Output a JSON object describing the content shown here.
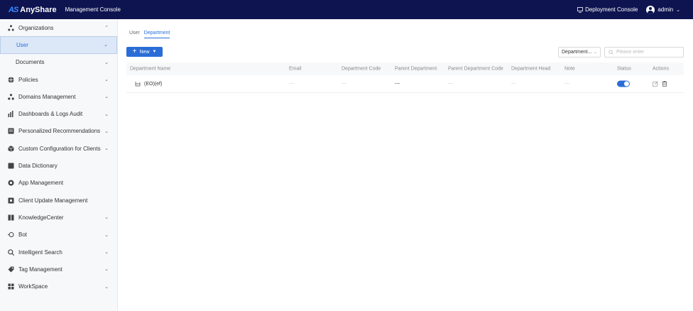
{
  "topbar": {
    "logo_mark": "AS",
    "logo_text": "AnyShare",
    "console_title": "Management Console",
    "deployment_console": "Deployment Console",
    "username": "admin"
  },
  "sidebar": {
    "items": [
      {
        "label": "Organizations",
        "icon": "organization-icon",
        "chevron": "⌃"
      },
      {
        "label": "User",
        "icon": "",
        "chevron": "⌄",
        "active": true,
        "sub": true
      },
      {
        "label": "Documents",
        "icon": "",
        "chevron": "⌄",
        "sub": true
      },
      {
        "label": "Policies",
        "icon": "policy-icon",
        "chevron": "⌄"
      },
      {
        "label": "Domains Management",
        "icon": "domain-icon",
        "chevron": "⌄"
      },
      {
        "label": "Dashboards & Logs Audit",
        "icon": "chart-icon",
        "chevron": "⌄"
      },
      {
        "label": "Personalized Recommendations",
        "icon": "recommend-icon",
        "chevron": "⌄"
      },
      {
        "label": "Custom Configuration for Clients",
        "icon": "cube-icon",
        "chevron": "⌄"
      },
      {
        "label": "Data Dictionary",
        "icon": "book-icon",
        "chevron": ""
      },
      {
        "label": "App Management",
        "icon": "app-icon",
        "chevron": ""
      },
      {
        "label": "Client Update Management",
        "icon": "update-icon",
        "chevron": ""
      },
      {
        "label": "KnowledgeCenter",
        "icon": "knowledge-icon",
        "chevron": "⌄"
      },
      {
        "label": "Bot",
        "icon": "bot-icon",
        "chevron": "⌄"
      },
      {
        "label": "Intelligent Search",
        "icon": "search-icon",
        "chevron": "⌄"
      },
      {
        "label": "Tag Management",
        "icon": "tag-icon",
        "chevron": "⌄"
      },
      {
        "label": "WorkSpace",
        "icon": "workspace-icon",
        "chevron": "⌄"
      }
    ]
  },
  "main": {
    "tabs": [
      {
        "label": "User",
        "active": false
      },
      {
        "label": "Department",
        "active": true
      }
    ],
    "new_button": "New",
    "filter_select": "Department...",
    "search_placeholder": "Please enter",
    "table": {
      "columns": [
        "Department Name",
        "Email",
        "Department Code",
        "Parent Department",
        "Parent Department Code",
        "Department Head",
        "Note",
        "Status",
        "Actions"
      ],
      "rows": [
        {
          "name": "(EO)(ef)",
          "email": "---",
          "code": "---",
          "parent": "---",
          "parent_code": "---",
          "head": "---",
          "note": "---",
          "status_enabled": true
        }
      ]
    }
  },
  "colors": {
    "topbar_bg": "#0e1450",
    "accent": "#2a6dd6",
    "sidebar_bg": "#f7f8fa",
    "active_bg": "#dce8f8"
  }
}
